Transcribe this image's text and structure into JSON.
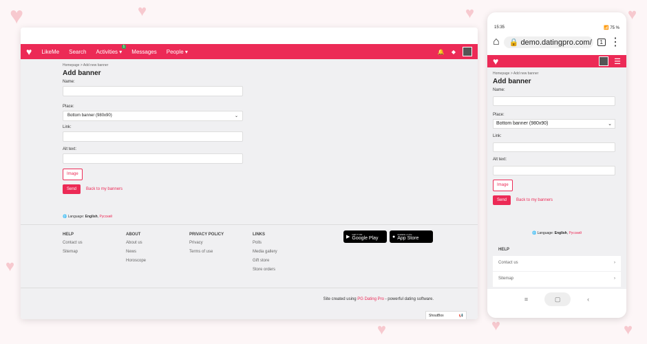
{
  "nav": {
    "brand": "LikeMe",
    "items": [
      "Search",
      "Activities",
      "Messages",
      "People"
    ],
    "activities_badge": "1"
  },
  "page": {
    "breadcrumb": "Homepage > Add new banner",
    "title": "Add banner",
    "name_label": "Name:",
    "place_label": "Place:",
    "place_value": "Bottom banner (980x90)",
    "link_label": "Link:",
    "alt_label": "Alt text:",
    "image_button": "Image",
    "send_button": "Send",
    "back_link": "Back to my banners"
  },
  "lang": {
    "label": "Language:",
    "english": "English",
    "russian": "Русский"
  },
  "footer": {
    "help": {
      "title": "HELP",
      "items": [
        "Contact us",
        "Sitemap"
      ]
    },
    "about": {
      "title": "ABOUT",
      "items": [
        "About us",
        "News",
        "Horoscope"
      ]
    },
    "privacy": {
      "title": "PRIVACY POLICY",
      "items": [
        "Privacy",
        "Terms of use"
      ]
    },
    "links": {
      "title": "LINKS",
      "items": [
        "Polls",
        "Media gallery",
        "Gift store",
        "Store orders"
      ]
    },
    "google_top": "GET IT ON",
    "google_name": "Google Play",
    "apple_top": "Available on the",
    "apple_name": "App Store",
    "credit_pre": "Site created using",
    "credit_link": "PG Dating Pro",
    "credit_post": "- powerful dating software.",
    "shoutbox": "ShoutBox"
  },
  "phone": {
    "time": "15:35",
    "battery": "75 %",
    "url": "demo.datingpro.com/",
    "tab_count": "1",
    "help_title": "HELP",
    "help_items": [
      "Contact us",
      "Sitemap"
    ]
  },
  "colors": {
    "accent": "#ec2a56"
  }
}
